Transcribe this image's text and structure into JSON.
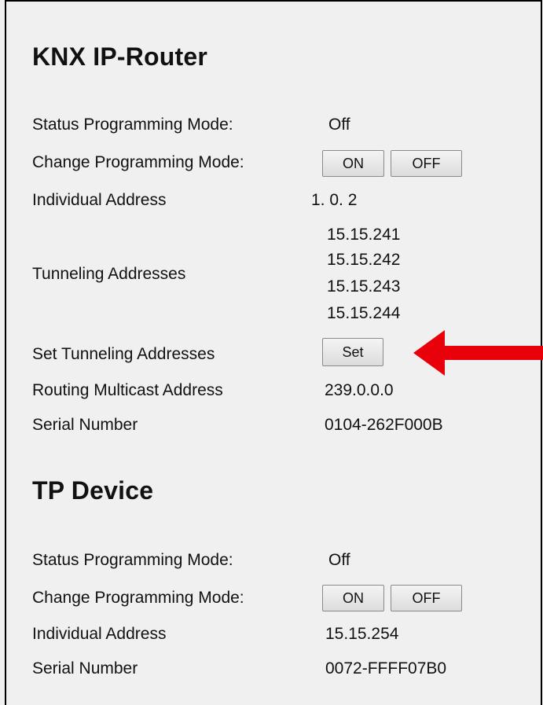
{
  "router": {
    "title": "KNX IP-Router",
    "status_label": "Status Programming Mode:",
    "status_value": "Off",
    "change_label": "Change Programming Mode:",
    "on_button": "ON",
    "off_button": "OFF",
    "individual_label": "Individual Address",
    "individual_value": "1. 0. 2",
    "tunneling_label": "Tunneling Addresses",
    "tunneling_values": [
      "15.15.241",
      "15.15.242",
      "15.15.243",
      "15.15.244"
    ],
    "set_tunneling_label": "Set Tunneling Addresses",
    "set_button": "Set",
    "multicast_label": "Routing Multicast Address",
    "multicast_value": "239.0.0.0",
    "serial_label": "Serial Number",
    "serial_value": "0104-262F000B"
  },
  "tp_device": {
    "title": "TP Device",
    "status_label": "Status Programming Mode:",
    "status_value": "Off",
    "change_label": "Change Programming Mode:",
    "on_button": "ON",
    "off_button": "OFF",
    "individual_label": "Individual Address",
    "individual_value": "15.15.254",
    "serial_label": "Serial Number",
    "serial_value": "0072-FFFF07B0"
  },
  "annotation": {
    "arrow_color": "#e8000b",
    "arrow_icon": "red-arrow-left-icon"
  }
}
